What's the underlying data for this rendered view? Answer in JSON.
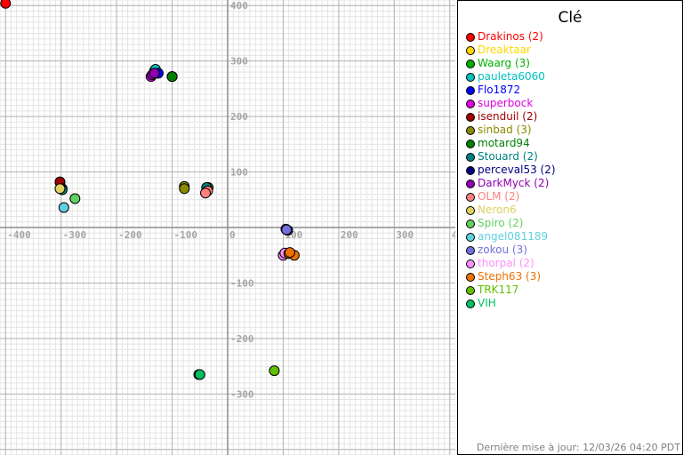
{
  "chart_data": {
    "type": "scatter",
    "xlim": [
      -410,
      410
    ],
    "ylim": [
      -410,
      410
    ],
    "grid": true,
    "grid_minor_step": 10,
    "grid_major_step": 100,
    "x_ticks": [
      -400,
      -300,
      -200,
      -100,
      0,
      100,
      200,
      300,
      400
    ],
    "y_ticks": [
      400,
      300,
      200,
      100,
      -100,
      -200,
      -300
    ],
    "legend_title": "Clé",
    "legend_placement": "right",
    "series": [
      {
        "name": "Drakinos (2)",
        "color": "#ff0000",
        "points": [
          [
            -400,
            404
          ],
          [
            -302,
            82
          ]
        ]
      },
      {
        "name": "Dreaktaar",
        "color": "#ffd700",
        "points": []
      },
      {
        "name": "Waarg (3)",
        "color": "#00b000",
        "points": [
          [
            -132,
            282
          ],
          [
            -127,
            278
          ],
          [
            -100,
            272
          ]
        ]
      },
      {
        "name": "pauleta6060",
        "color": "#00c0c0",
        "points": [
          [
            -130,
            285
          ]
        ]
      },
      {
        "name": "Flo1872",
        "color": "#0000ff",
        "points": [
          [
            -125,
            278
          ]
        ]
      },
      {
        "name": "superbock",
        "color": "#e000e0",
        "points": [
          [
            -138,
            272
          ]
        ]
      },
      {
        "name": "isenduil (2)",
        "color": "#a00000",
        "points": [
          [
            -302,
            82
          ],
          [
            -298,
            70
          ]
        ]
      },
      {
        "name": "sinbad (3)",
        "color": "#8a8a00",
        "points": [
          [
            -78,
            74
          ],
          [
            -78,
            70
          ],
          [
            -35,
            72
          ]
        ]
      },
      {
        "name": "motard94",
        "color": "#008000",
        "points": [
          [
            -100,
            272
          ]
        ]
      },
      {
        "name": "Stouard (2)",
        "color": "#008080",
        "points": [
          [
            -298,
            68
          ],
          [
            -38,
            72
          ]
        ]
      },
      {
        "name": "perceval53 (2)",
        "color": "#000080",
        "points": [
          [
            105,
            -3
          ],
          [
            108,
            -5
          ]
        ]
      },
      {
        "name": "DarkMyck (2)",
        "color": "#9000b0",
        "points": [
          [
            -136,
            275
          ],
          [
            -132,
            278
          ]
        ]
      },
      {
        "name": "OLM (2)",
        "color": "#ff8080",
        "points": [
          [
            -36,
            66
          ],
          [
            -40,
            62
          ]
        ]
      },
      {
        "name": "Neron6",
        "color": "#e0d060",
        "points": [
          [
            -302,
            70
          ]
        ]
      },
      {
        "name": "Spiro (2)",
        "color": "#60d060",
        "points": [
          [
            -275,
            52
          ],
          [
            -52,
            -265
          ]
        ]
      },
      {
        "name": "angel081189",
        "color": "#60d0e0",
        "points": [
          [
            -295,
            36
          ]
        ]
      },
      {
        "name": "zokou (3)",
        "color": "#7070e0",
        "points": [
          [
            105,
            -3
          ],
          [
            108,
            -5
          ],
          [
            106,
            -4
          ]
        ]
      },
      {
        "name": "thorpal (2)",
        "color": "#ff90ff",
        "points": [
          [
            100,
            -50
          ],
          [
            103,
            -46
          ]
        ]
      },
      {
        "name": "Steph63 (3)",
        "color": "#f07000",
        "points": [
          [
            110,
            -47
          ],
          [
            120,
            -50
          ],
          [
            112,
            -45
          ]
        ]
      },
      {
        "name": "TRK117",
        "color": "#60c000",
        "points": [
          [
            84,
            -258
          ]
        ]
      },
      {
        "name": "VIH",
        "color": "#00c060",
        "points": [
          [
            -50,
            -265
          ]
        ]
      }
    ]
  },
  "legend": {
    "title": "Clé",
    "items": [
      {
        "label": "Drakinos (2)",
        "color": "#ff0000"
      },
      {
        "label": "Dreaktaar",
        "color": "#ffd700"
      },
      {
        "label": "Waarg (3)",
        "color": "#00b000"
      },
      {
        "label": "pauleta6060",
        "color": "#00c0c0"
      },
      {
        "label": "Flo1872",
        "color": "#0000ff"
      },
      {
        "label": "superbock",
        "color": "#e000e0"
      },
      {
        "label": "isenduil (2)",
        "color": "#a00000"
      },
      {
        "label": "sinbad (3)",
        "color": "#8a8a00"
      },
      {
        "label": "motard94",
        "color": "#008000"
      },
      {
        "label": "Stouard (2)",
        "color": "#008080"
      },
      {
        "label": "perceval53 (2)",
        "color": "#000080"
      },
      {
        "label": "DarkMyck (2)",
        "color": "#9000b0"
      },
      {
        "label": "OLM (2)",
        "color": "#ff8080"
      },
      {
        "label": "Neron6",
        "color": "#e0d060"
      },
      {
        "label": "Spiro (2)",
        "color": "#60d060"
      },
      {
        "label": "angel081189",
        "color": "#60d0e0"
      },
      {
        "label": "zokou (3)",
        "color": "#7070e0"
      },
      {
        "label": "thorpal (2)",
        "color": "#ff90ff"
      },
      {
        "label": "Steph63 (3)",
        "color": "#f07000"
      },
      {
        "label": "TRK117",
        "color": "#60c000"
      },
      {
        "label": "VIH",
        "color": "#00c060"
      }
    ]
  },
  "footer": {
    "updated": "Dernière mise à jour: 12/03/26 04:20 PDT"
  }
}
